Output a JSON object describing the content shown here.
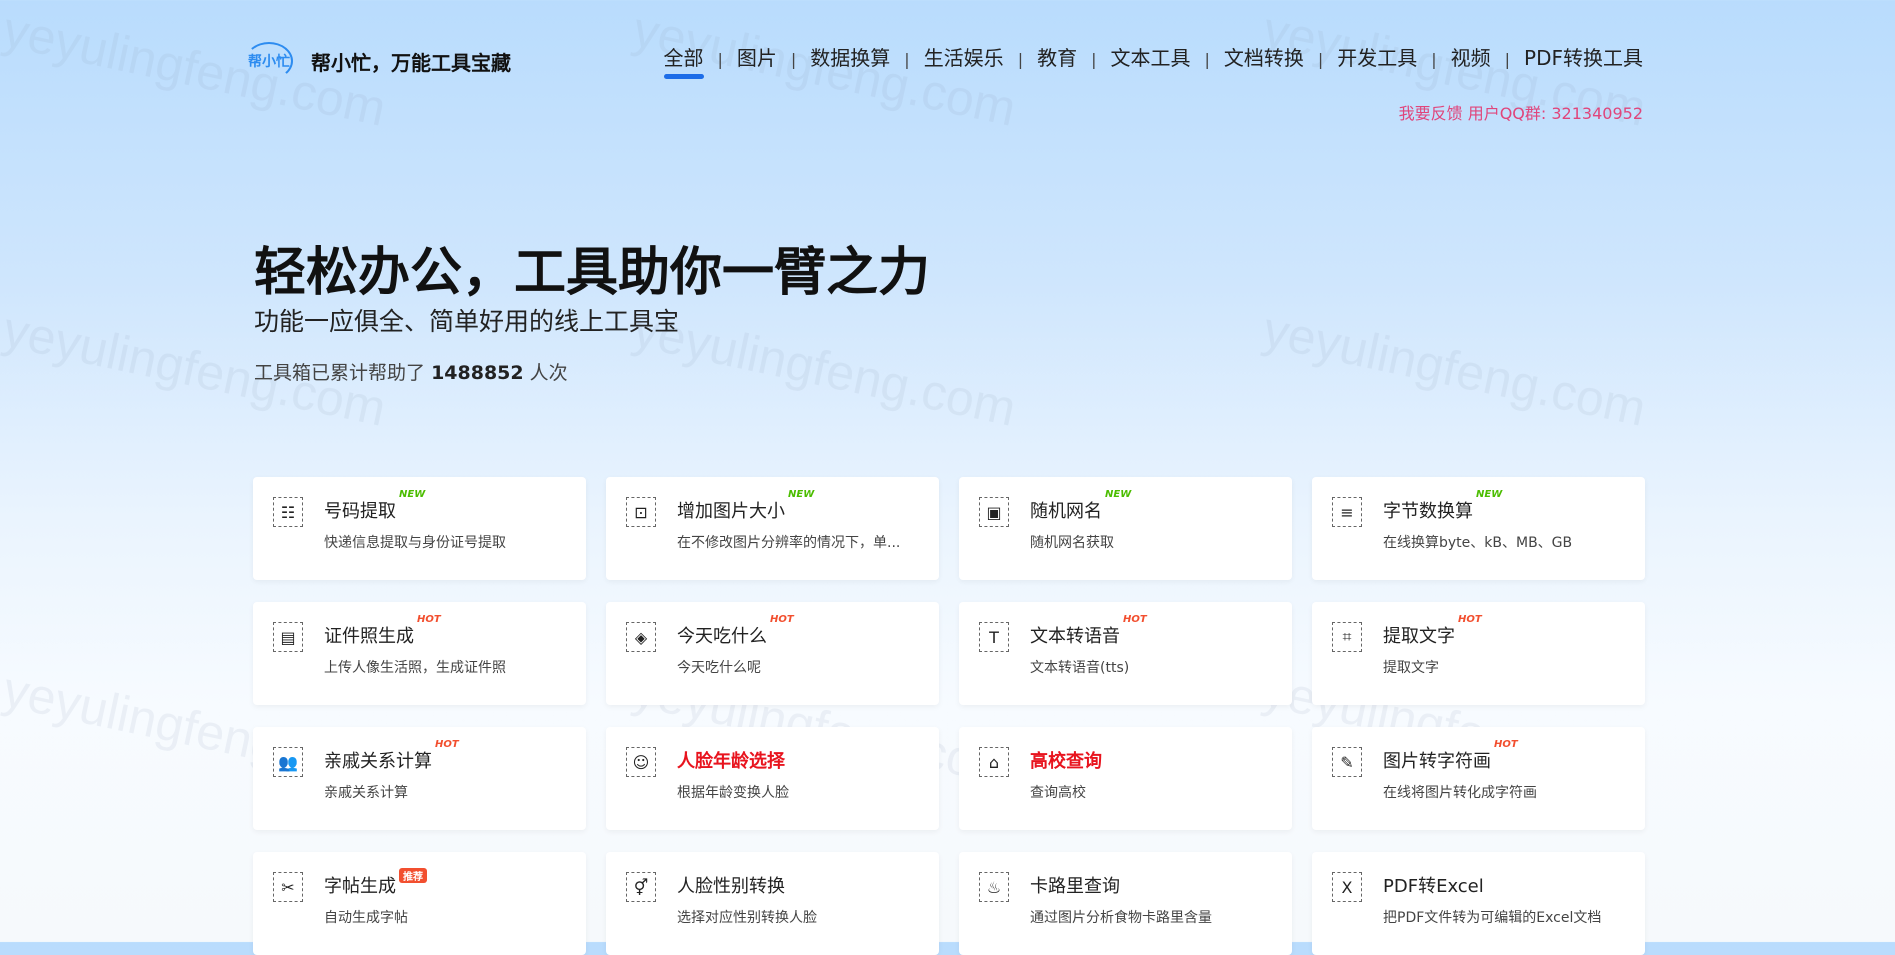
{
  "brand": {
    "badge": "帮小忙",
    "name": "帮小忙，万能工具宝藏"
  },
  "nav": {
    "items": [
      "全部",
      "图片",
      "数据换算",
      "生活娱乐",
      "教育",
      "文本工具",
      "文档转换",
      "开发工具",
      "视频",
      "PDF转换工具"
    ],
    "separator": "|"
  },
  "feedback": "我要反馈 用户QQ群: 321340952",
  "hero": {
    "title": "轻松办公，工具助你一臂之力",
    "subtitle": "功能一应俱全、简单好用的线上工具宝",
    "count_prefix": "工具箱已累计帮助了",
    "count": "1488852",
    "count_suffix": "人次"
  },
  "watermark": "yeyulingfeng.com",
  "tools": [
    {
      "title": "号码提取",
      "desc": "快递信息提取与身份证号提取",
      "tag": "NEW",
      "tag_type": "new",
      "icon": "contact-card-icon",
      "glyph": "☷"
    },
    {
      "title": "增加图片大小",
      "desc": "在不修改图片分辨率的情况下，单...",
      "tag": "NEW",
      "tag_type": "new",
      "icon": "image-resize-icon",
      "glyph": "⊡"
    },
    {
      "title": "随机网名",
      "desc": "随机网名获取",
      "tag": "NEW",
      "tag_type": "new",
      "icon": "id-badge-icon",
      "glyph": "▣"
    },
    {
      "title": "字节数换算",
      "desc": "在线换算byte、kB、MB、GB",
      "tag": "NEW",
      "tag_type": "new",
      "icon": "list-calc-icon",
      "glyph": "≡"
    },
    {
      "title": "证件照生成",
      "desc": "上传人像生活照，生成证件照",
      "tag": "HOT",
      "tag_type": "hot",
      "icon": "id-photo-icon",
      "glyph": "▤"
    },
    {
      "title": "今天吃什么",
      "desc": "今天吃什么呢",
      "tag": "HOT",
      "tag_type": "hot",
      "icon": "food-icon",
      "glyph": "◈"
    },
    {
      "title": "文本转语音",
      "desc": "文本转语音(tts)",
      "tag": "HOT",
      "tag_type": "hot",
      "icon": "text-to-speech-icon",
      "glyph": "T"
    },
    {
      "title": "提取文字",
      "desc": "提取文字",
      "tag": "HOT",
      "tag_type": "hot",
      "icon": "ocr-icon",
      "glyph": "⌗"
    },
    {
      "title": "亲戚关系计算",
      "desc": "亲戚关系计算",
      "tag": "HOT",
      "tag_type": "hot",
      "icon": "relatives-icon",
      "glyph": "👥"
    },
    {
      "title": "人脸年龄选择",
      "desc": "根据年龄变换人脸",
      "tag": "",
      "tag_type": "",
      "icon": "face-age-icon",
      "glyph": "☺",
      "red": true
    },
    {
      "title": "高校查询",
      "desc": "查询高校",
      "tag": "",
      "tag_type": "",
      "icon": "university-icon",
      "glyph": "⌂",
      "red": true
    },
    {
      "title": "图片转字符画",
      "desc": "在线将图片转化成字符画",
      "tag": "HOT",
      "tag_type": "hot",
      "icon": "image-to-text-icon",
      "glyph": "✎"
    },
    {
      "title": "字帖生成",
      "desc": "自动生成字帖",
      "tag": "推荐",
      "tag_type": "rec",
      "icon": "copybook-icon",
      "glyph": "✂"
    },
    {
      "title": "人脸性别转换",
      "desc": "选择对应性别转换人脸",
      "tag": "",
      "tag_type": "",
      "icon": "gender-icon",
      "glyph": "⚥"
    },
    {
      "title": "卡路里查询",
      "desc": "通过图片分析食物卡路里含量",
      "tag": "",
      "tag_type": "",
      "icon": "calorie-icon",
      "glyph": "♨"
    },
    {
      "title": "PDF转Excel",
      "desc": "把PDF文件转为可编辑的Excel文档",
      "tag": "",
      "tag_type": "",
      "icon": "excel-icon",
      "glyph": "X"
    }
  ]
}
